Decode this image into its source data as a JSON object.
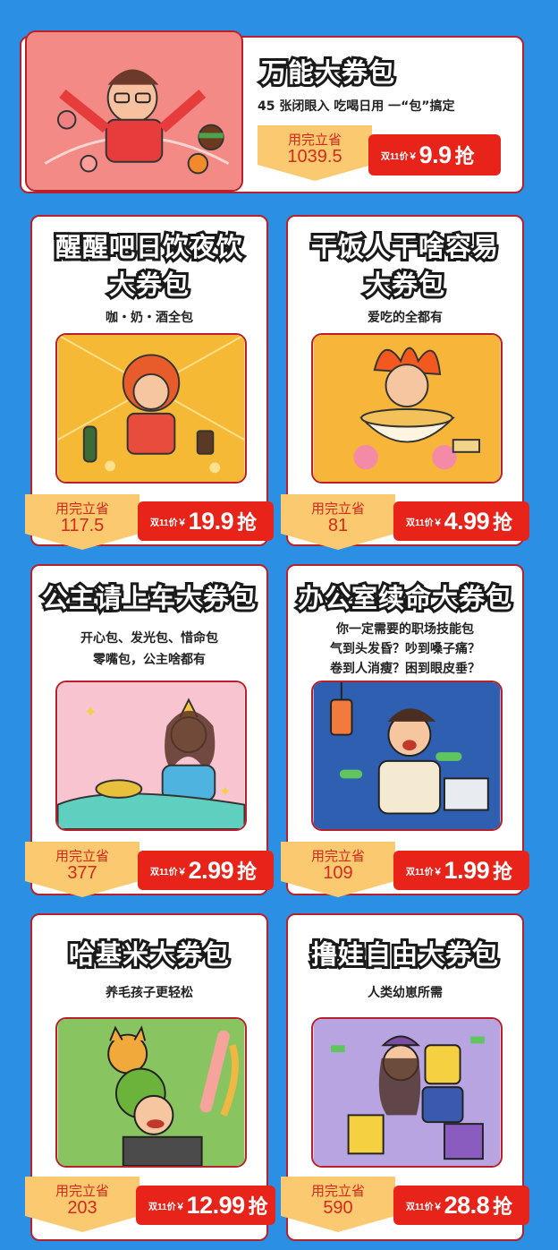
{
  "colors": {
    "background": "#2b8fe3",
    "card_border": "#b8202b",
    "price_red": "#e8231a",
    "save_yellow": "#fbc970",
    "save_text": "#d72a1c"
  },
  "featured": {
    "title": "万能大券包",
    "subtitle": "45 张闭眼入 吃喝日用 一“包”搞定",
    "save_label": "用完立省",
    "save_value": "1039.5",
    "price_prefix": "双11价￥",
    "price": "9.9",
    "action": "抢"
  },
  "cards": [
    {
      "title_line1": "醒醒吧日饮夜饮",
      "title_line2": "大券包",
      "sub_lines": [
        "咖・奶・酒全包"
      ],
      "save_label": "用完立省",
      "save_value": "117.5",
      "price_prefix": "双11价￥",
      "price": "19.9",
      "action": "抢"
    },
    {
      "title_line1": "干饭人干啥容易",
      "title_line2": "大券包",
      "sub_lines": [
        "爱吃的全都有"
      ],
      "save_label": "用完立省",
      "save_value": "81",
      "price_prefix": "双11价￥",
      "price": "4.99",
      "action": "抢"
    },
    {
      "title_line1": "公主请上车大券包",
      "title_line2": "",
      "sub_lines": [
        "开心包、发光包、惜命包",
        "零嘴包，公主啥都有"
      ],
      "save_label": "用完立省",
      "save_value": "377",
      "price_prefix": "双11价￥",
      "price": "2.99",
      "action": "抢"
    },
    {
      "title_line1": "办公室续命大券包",
      "title_line2": "",
      "sub_lines": [
        "你一定需要的职场技能包",
        "气到头发昏？吵到嗓子痛？",
        "卷到人消瘦？困到眼皮垂？"
      ],
      "save_label": "用完立省",
      "save_value": "109",
      "price_prefix": "双11价￥",
      "price": "1.99",
      "action": "抢"
    },
    {
      "title_line1": "哈基米大券包",
      "title_line2": "",
      "sub_lines": [
        "养毛孩子更轻松"
      ],
      "save_label": "用完立省",
      "save_value": "203",
      "price_prefix": "双11价￥",
      "price": "12.99",
      "action": "抢"
    },
    {
      "title_line1": "撸娃自由大券包",
      "title_line2": "",
      "sub_lines": [
        "人类幼崽所需"
      ],
      "save_label": "用完立省",
      "save_value": "590",
      "price_prefix": "双11价￥",
      "price": "28.8",
      "action": "抢"
    }
  ]
}
